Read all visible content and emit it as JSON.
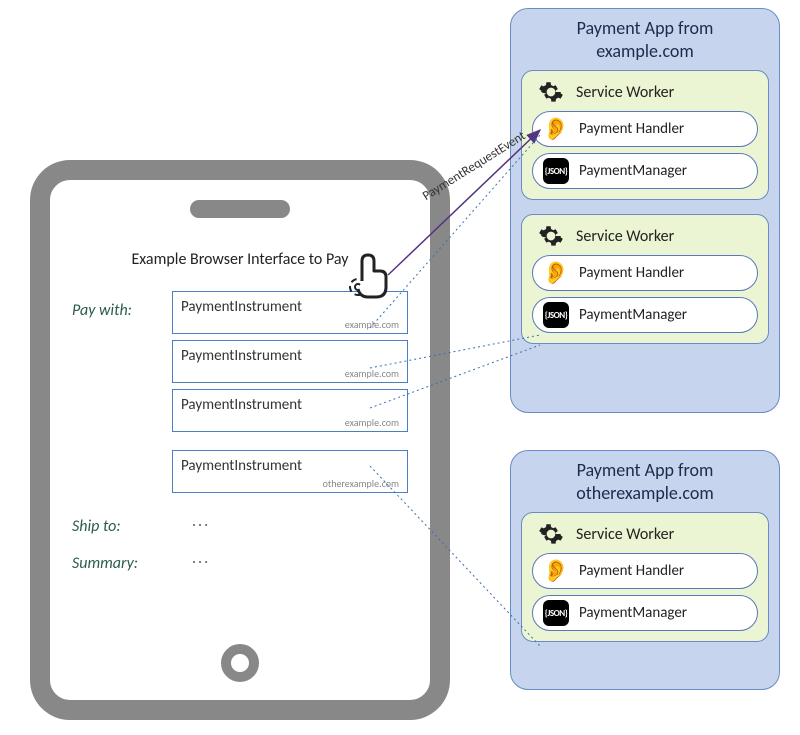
{
  "phone": {
    "title": "Example Browser Interface to Pay",
    "payWithLabel": "Pay with:",
    "shipToLabel": "Ship to:",
    "shipToValue": "...",
    "summaryLabel": "Summary:",
    "summaryValue": "...",
    "instruments": [
      {
        "name": "PaymentInstrument",
        "origin": "example.com"
      },
      {
        "name": "PaymentInstrument",
        "origin": "example.com"
      },
      {
        "name": "PaymentInstrument",
        "origin": "example.com"
      },
      {
        "name": "PaymentInstrument",
        "origin": "otherexample.com"
      }
    ]
  },
  "eventLabel": "PaymentRequestEvent",
  "apps": [
    {
      "titleLine1": "Payment App from",
      "titleLine2": "example.com",
      "serviceWorkers": [
        {
          "title": "Service Worker",
          "handlerLabel": "Payment Handler",
          "managerLabel": "PaymentManager"
        },
        {
          "title": "Service Worker",
          "handlerLabel": "Payment Handler",
          "managerLabel": "PaymentManager"
        }
      ]
    },
    {
      "titleLine1": "Payment App from",
      "titleLine2": "otherexample.com",
      "serviceWorkers": [
        {
          "title": "Service Worker",
          "handlerLabel": "Payment Handler",
          "managerLabel": "PaymentManager"
        }
      ]
    }
  ],
  "icons": {
    "gear": "gear-icon",
    "ear": "ear-icon",
    "json": "json-icon",
    "hand": "tap-hand-icon"
  }
}
